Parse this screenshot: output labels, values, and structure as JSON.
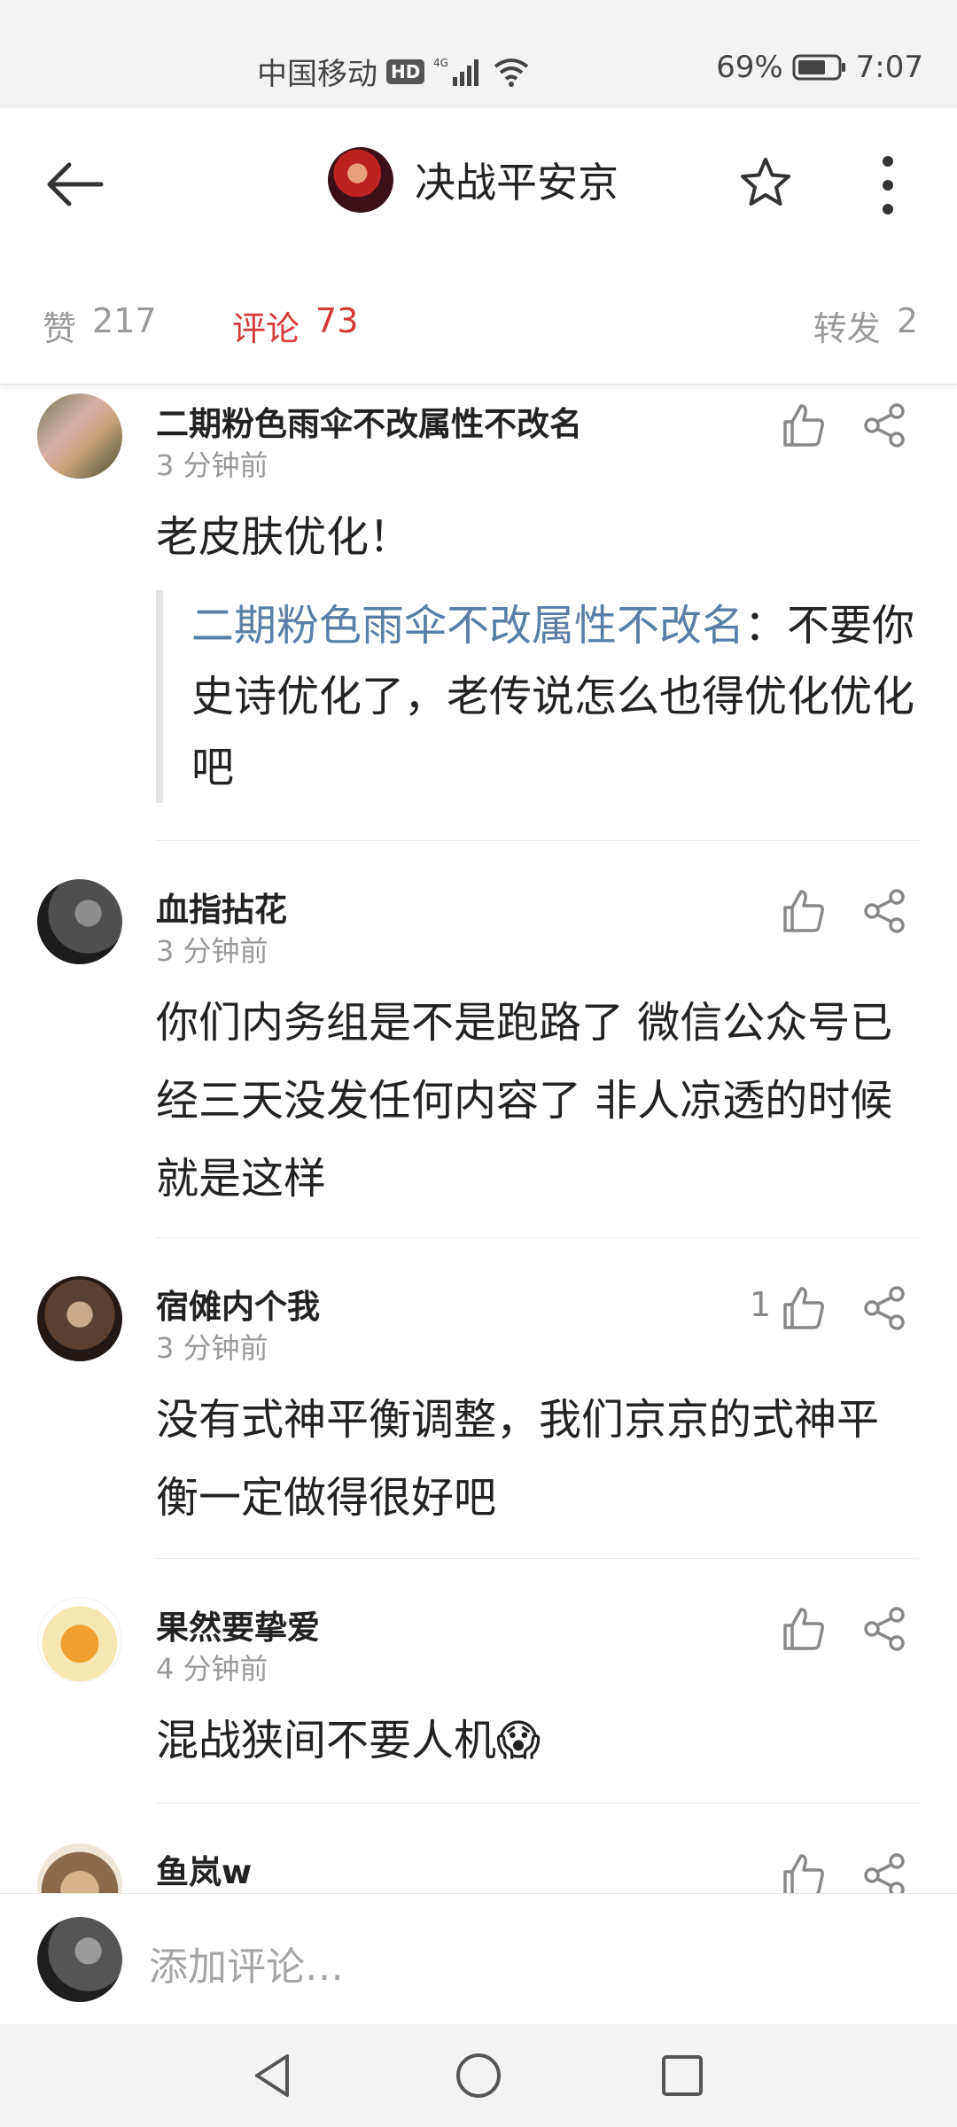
{
  "status": {
    "carrier": "中国移动",
    "hd": "HD",
    "network": "4G",
    "battery": "69%",
    "time": "7:07"
  },
  "header": {
    "title": "决战平安京"
  },
  "tabs": {
    "likes": {
      "label": "赞",
      "count": "217"
    },
    "comments": {
      "label": "评论",
      "count": "73"
    },
    "reposts": {
      "label": "转发",
      "count": "2"
    }
  },
  "comments": [
    {
      "name": "二期粉色雨伞不改属性不改名",
      "time": "3 分钟前",
      "text": "老皮肤优化！",
      "quote": {
        "author": "二期粉色雨伞不改属性不改名",
        "sep": "：",
        "text": "不要你史诗优化了，老传说怎么也得优化优化吧"
      }
    },
    {
      "name": "血指拈花",
      "time": "3 分钟前",
      "text": "你们内务组是不是跑路了 微信公众号已经三天没发任何内容了 非人凉透的时候就是这样"
    },
    {
      "name": "宿傩内个我",
      "time": "3 分钟前",
      "likes": "1",
      "text": "没有式神平衡调整，我们京京的式神平衡一定做得很好吧"
    },
    {
      "name": "果然要挚爱",
      "time": "4 分钟前",
      "text": "混战狭间不要人机😱"
    },
    {
      "name": "鱼岚w"
    }
  ],
  "input": {
    "placeholder": "添加评论…"
  },
  "colors": {
    "accent": "#d43a3a",
    "quote_author": "#5a7fa6",
    "muted": "#9a9a9a"
  }
}
